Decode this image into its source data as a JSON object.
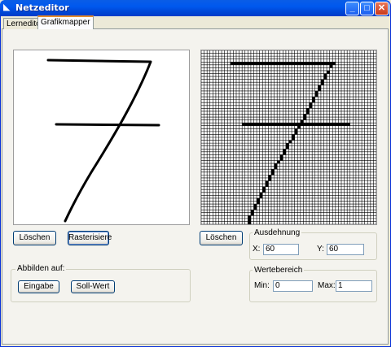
{
  "window": {
    "title": "Netzeditor"
  },
  "tabs": [
    {
      "label": "Lerneditor"
    },
    {
      "label": "Grafikmapper"
    }
  ],
  "left": {
    "clear_label": "Löschen",
    "rasterize_label": "Rasterisiere"
  },
  "right": {
    "clear_label": "Löschen"
  },
  "map_group": {
    "label": "Abbilden auf:",
    "input_label": "Eingabe",
    "target_label": "Soll-Wert"
  },
  "extent": {
    "label": "Ausdehnung",
    "x_label": "X:",
    "x_value": "60",
    "y_label": "Y:",
    "y_value": "60"
  },
  "range": {
    "label": "Wertebereich",
    "min_label": "Min:",
    "min_value": "0",
    "max_label": "Max:",
    "max_value": "1"
  },
  "colors": {
    "titlebar": "#0058ee",
    "grid_line": "#000000"
  },
  "icons": {
    "app": "app-icon",
    "minimize": "minimize-icon",
    "maximize": "maximize-icon",
    "close": "close-icon"
  },
  "grid": {
    "cols": 60,
    "rows": 60
  },
  "raster_cells": [
    [
      10,
      4
    ],
    [
      11,
      4
    ],
    [
      12,
      4
    ],
    [
      13,
      4
    ],
    [
      14,
      4
    ],
    [
      15,
      4
    ],
    [
      16,
      4
    ],
    [
      17,
      4
    ],
    [
      18,
      4
    ],
    [
      19,
      4
    ],
    [
      20,
      4
    ],
    [
      21,
      4
    ],
    [
      22,
      4
    ],
    [
      23,
      4
    ],
    [
      24,
      4
    ],
    [
      25,
      4
    ],
    [
      26,
      4
    ],
    [
      27,
      4
    ],
    [
      28,
      4
    ],
    [
      29,
      4
    ],
    [
      30,
      4
    ],
    [
      31,
      4
    ],
    [
      32,
      4
    ],
    [
      33,
      4
    ],
    [
      34,
      4
    ],
    [
      35,
      4
    ],
    [
      36,
      4
    ],
    [
      37,
      4
    ],
    [
      38,
      4
    ],
    [
      39,
      4
    ],
    [
      40,
      4
    ],
    [
      41,
      4
    ],
    [
      42,
      4
    ],
    [
      43,
      4
    ],
    [
      44,
      4
    ],
    [
      45,
      4
    ],
    [
      44,
      5
    ],
    [
      43,
      7
    ],
    [
      42,
      8
    ],
    [
      42,
      9
    ],
    [
      41,
      10
    ],
    [
      41,
      11
    ],
    [
      40,
      12
    ],
    [
      40,
      13
    ],
    [
      39,
      14
    ],
    [
      39,
      15
    ],
    [
      38,
      16
    ],
    [
      38,
      17
    ],
    [
      37,
      18
    ],
    [
      37,
      19
    ],
    [
      36,
      20
    ],
    [
      36,
      21
    ],
    [
      35,
      22
    ],
    [
      35,
      23
    ],
    [
      34,
      24
    ],
    [
      34,
      25
    ],
    [
      33,
      26
    ],
    [
      32,
      27
    ],
    [
      32,
      28
    ],
    [
      31,
      29
    ],
    [
      31,
      30
    ],
    [
      30,
      31
    ],
    [
      29,
      32
    ],
    [
      29,
      33
    ],
    [
      28,
      34
    ],
    [
      28,
      35
    ],
    [
      27,
      36
    ],
    [
      27,
      37
    ],
    [
      26,
      38
    ],
    [
      25,
      39
    ],
    [
      25,
      40
    ],
    [
      24,
      41
    ],
    [
      24,
      42
    ],
    [
      23,
      43
    ],
    [
      23,
      44
    ],
    [
      22,
      45
    ],
    [
      22,
      46
    ],
    [
      21,
      47
    ],
    [
      21,
      48
    ],
    [
      20,
      49
    ],
    [
      20,
      50
    ],
    [
      19,
      51
    ],
    [
      19,
      52
    ],
    [
      18,
      53
    ],
    [
      18,
      54
    ],
    [
      17,
      55
    ],
    [
      17,
      56
    ],
    [
      16,
      57
    ],
    [
      16,
      58
    ],
    [
      16,
      59
    ],
    [
      14,
      25
    ],
    [
      15,
      25
    ],
    [
      16,
      25
    ],
    [
      17,
      25
    ],
    [
      18,
      25
    ],
    [
      19,
      25
    ],
    [
      20,
      25
    ],
    [
      21,
      25
    ],
    [
      22,
      25
    ],
    [
      23,
      25
    ],
    [
      24,
      25
    ],
    [
      25,
      25
    ],
    [
      26,
      25
    ],
    [
      27,
      25
    ],
    [
      28,
      25
    ],
    [
      29,
      25
    ],
    [
      30,
      25
    ],
    [
      31,
      25
    ],
    [
      32,
      25
    ],
    [
      33,
      25
    ],
    [
      34,
      25
    ],
    [
      35,
      25
    ],
    [
      36,
      25
    ],
    [
      37,
      25
    ],
    [
      38,
      25
    ],
    [
      39,
      25
    ],
    [
      40,
      25
    ],
    [
      41,
      25
    ],
    [
      42,
      25
    ],
    [
      43,
      25
    ],
    [
      44,
      25
    ],
    [
      45,
      25
    ],
    [
      46,
      25
    ],
    [
      47,
      25
    ],
    [
      48,
      25
    ],
    [
      49,
      25
    ],
    [
      50,
      25
    ]
  ]
}
